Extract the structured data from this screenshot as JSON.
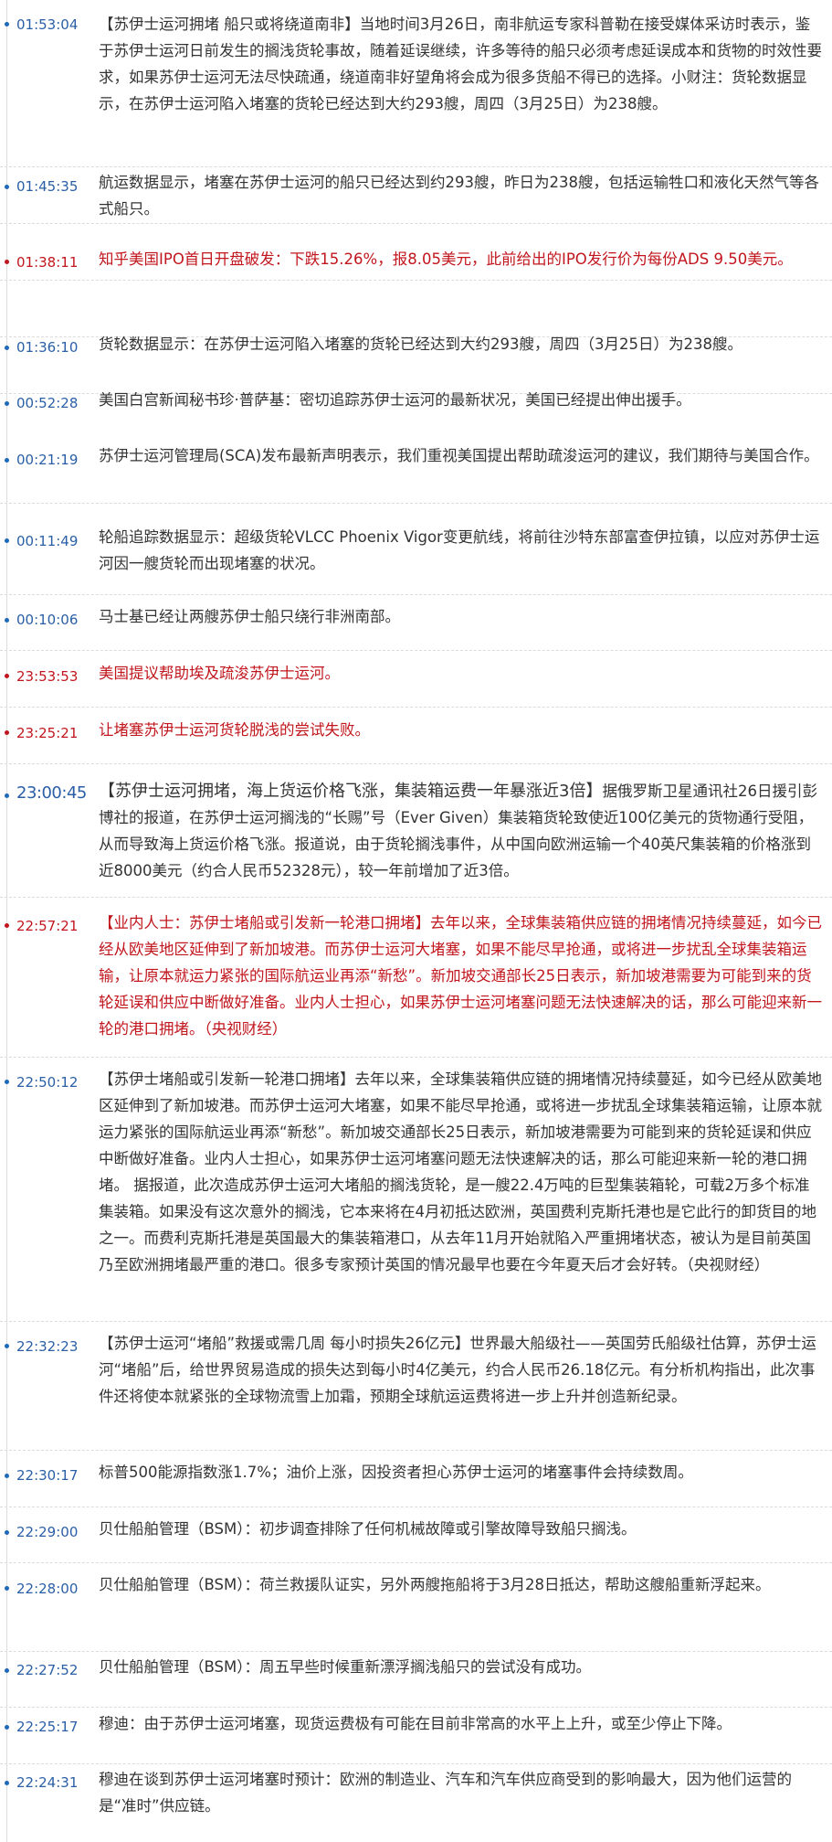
{
  "news": [
    {
      "time": "01:53:04",
      "style": "",
      "title": "【苏伊士运河拥堵 船只或将绕道南非】",
      "text": "当地时间3月26日，南非航运专家科普勒在接受媒体采访时表示，鉴于苏伊士运河日前发生的搁浅货轮事故，随着延误继续，许多等待的船只必须考虑延误成本和货物的时效性要求，如果苏伊士运河无法尽快疏通，绕道南非好望角将会成为很多货船不得已的选择。小财注：货轮数据显示，在苏伊士运河陷入堵塞的货轮已经达到大约293艘，周四（3月25日）为238艘。"
    },
    {
      "time": "01:45:35",
      "style": "",
      "title": "",
      "text": "航运数据显示，堵塞在苏伊士运河的船只已经达到约293艘，昨日为238艘，包括运输牲口和液化天然气等各式船只。"
    },
    {
      "time": "01:38:11",
      "style": "red",
      "title": "",
      "text": "知乎美国IPO首日开盘破发：下跌15.26%，报8.05美元，此前给出的IPO发行价为每份ADS 9.50美元。"
    },
    {
      "time": "01:36:10",
      "style": "",
      "title": "",
      "text": "货轮数据显示：在苏伊士运河陷入堵塞的货轮已经达到大约293艘，周四（3月25日）为238艘。"
    },
    {
      "time": "00:52:28",
      "style": "",
      "title": "",
      "text": "美国白宫新闻秘书珍·普萨基：密切追踪苏伊士运河的最新状况，美国已经提出伸出援手。"
    },
    {
      "time": "00:21:19",
      "style": "",
      "title": "",
      "text": "苏伊士运河管理局(SCA)发布最新声明表示，我们重视美国提出帮助疏浚运河的建议，我们期待与美国合作。"
    },
    {
      "time": "00:11:49",
      "style": "",
      "title": "",
      "text": "轮船追踪数据显示：超级货轮VLCC Phoenix Vigor变更航线，将前往沙特东部富查伊拉镇，以应对苏伊士运河因一艘货轮而出现堵塞的状况。"
    },
    {
      "time": "00:10:06",
      "style": "",
      "title": "",
      "text": "马士基已经让两艘苏伊士船只绕行非洲南部。"
    },
    {
      "time": "23:53:53",
      "style": "red",
      "title": "",
      "text": "美国提议帮助埃及疏浚苏伊士运河。"
    },
    {
      "time": "23:25:21",
      "style": "red",
      "title": "",
      "text": "让堵塞苏伊士运河货轮脱浅的尝试失败。"
    },
    {
      "time": "23:00:45",
      "style": "big",
      "title": "【苏伊士运河拥堵，海上货运价格飞涨，集装箱运费一年暴涨近3倍】",
      "text": "据俄罗斯卫星通讯社26日援引彭博社的报道，在苏伊士运河搁浅的“长赐”号（Ever Given）集装箱货轮致使近100亿美元的货物通行受阻，从而导致海上货运价格飞涨。报道说，由于货轮搁浅事件，从中国向欧洲运输一个40英尺集装箱的价格涨到近8000美元（约合人民币52328元），较一年前增加了近3倍。"
    },
    {
      "time": "22:57:21",
      "style": "red",
      "title": "【业内人士：苏伊士堵船或引发新一轮港口拥堵】",
      "text": "去年以来，全球集装箱供应链的拥堵情况持续蔓延，如今已经从欧美地区延伸到了新加坡港。而苏伊士运河大堵塞，如果不能尽早抢通，或将进一步扰乱全球集装箱运输，让原本就运力紧张的国际航运业再添“新愁”。新加坡交通部长25日表示，新加坡港需要为可能到来的货轮延误和供应中断做好准备。业内人士担心，如果苏伊士运河堵塞问题无法快速解决的话，那么可能迎来新一轮的港口拥堵。（央视财经）"
    },
    {
      "time": "22:50:12",
      "style": "",
      "title": "【苏伊士堵船或引发新一轮港口拥堵】",
      "text": "去年以来，全球集装箱供应链的拥堵情况持续蔓延，如今已经从欧美地区延伸到了新加坡港。而苏伊士运河大堵塞，如果不能尽早抢通，或将进一步扰乱全球集装箱运输，让原本就运力紧张的国际航运业再添“新愁”。新加坡交通部长25日表示，新加坡港需要为可能到来的货轮延误和供应中断做好准备。业内人士担心，如果苏伊士运河堵塞问题无法快速解决的话，那么可能迎来新一轮的港口拥堵。 据报道，此次造成苏伊士运河大堵船的搁浅货轮，是一艘22.4万吨的巨型集装箱轮，可载2万多个标准集装箱。如果没有这次意外的搁浅，它本来将在4月初抵达欧洲，英国费利克斯托港也是它此行的卸货目的地之一。而费利克斯托港是英国最大的集装箱港口，从去年11月开始就陷入严重拥堵状态，被认为是目前英国乃至欧洲拥堵最严重的港口。很多专家预计英国的情况最早也要在今年夏天后才会好转。（央视财经）"
    },
    {
      "time": "22:32:23",
      "style": "",
      "title": "【苏伊士运河“堵船”救援或需几周 每小时损失26亿元】",
      "text": "世界最大船级社——英国劳氏船级社估算，苏伊士运河“堵船”后，给世界贸易造成的损失达到每小时4亿美元，约合人民币26.18亿元。有分析机构指出，此次事件还将使本就紧张的全球物流雪上加霜，预期全球航运运费将进一步上升并创造新纪录。"
    },
    {
      "time": "22:30:17",
      "style": "",
      "title": "",
      "text": "标普500能源指数涨1.7%；油价上涨，因投资者担心苏伊士运河的堵塞事件会持续数周。"
    },
    {
      "time": "22:29:00",
      "style": "",
      "title": "",
      "text": "贝仕船舶管理（BSM）：初步调查排除了任何机械故障或引擎故障导致船只搁浅。"
    },
    {
      "time": "22:28:00",
      "style": "",
      "title": "",
      "text": "贝仕船舶管理（BSM）：荷兰救援队证实，另外两艘拖船将于3月28日抵达，帮助这艘船重新浮起来。"
    },
    {
      "time": "22:27:52",
      "style": "",
      "title": "",
      "text": "贝仕船舶管理（BSM）：周五早些时候重新漂浮搁浅船只的尝试没有成功。"
    },
    {
      "time": "22:25:17",
      "style": "",
      "title": "",
      "text": "穆迪：由于苏伊士运河堵塞，现货运费极有可能在目前非常高的水平上上升，或至少停止下降。"
    },
    {
      "time": "22:24:31",
      "style": "",
      "title": "",
      "text": "穆迪在谈到苏伊士运河堵塞时预计：欧洲的制造业、汽车和汽车供应商受到的影响最大，因为他们运营的是“准时”供应链。"
    }
  ]
}
